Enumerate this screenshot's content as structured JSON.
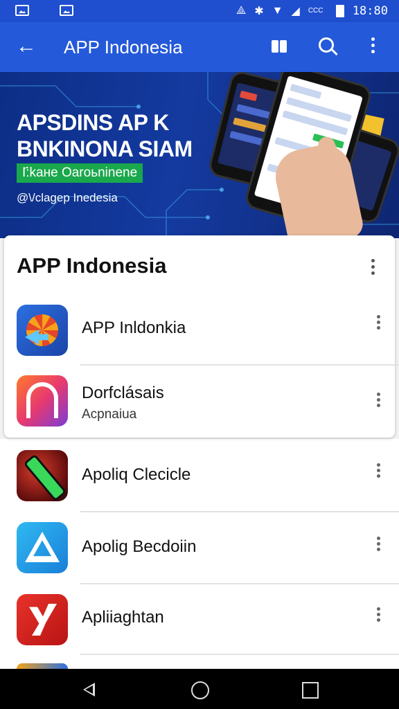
{
  "status_bar": {
    "network": "CCC",
    "time": "18:80"
  },
  "app_bar": {
    "title": "APP Indonesia"
  },
  "banner": {
    "headline_line1": "APSDINS AP K",
    "headline_line2": "BNKINONA SIAM",
    "badge": "I҃:kaнe Oaroьninene",
    "subtitle": "@\\/clagep Inedesia"
  },
  "card": {
    "title": "APP Indonesia"
  },
  "apps": [
    {
      "name": "APP Inldonkia",
      "sub": "",
      "icon": "sun-arrow-icon"
    },
    {
      "name": "Dorfclásais",
      "sub": "Acpnaiua",
      "icon": "letter-a-icon"
    },
    {
      "name": "Apoliq Clecicle",
      "sub": "",
      "icon": "tool-icon"
    },
    {
      "name": "Apolig Becdoiin",
      "sub": "",
      "icon": "triangle-icon"
    },
    {
      "name": "Apliiaghtan",
      "sub": "",
      "icon": "letter-y-icon"
    }
  ],
  "colors": {
    "primary": "#2459d9",
    "status": "#1f4fcf",
    "badge": "#1aa84c"
  }
}
